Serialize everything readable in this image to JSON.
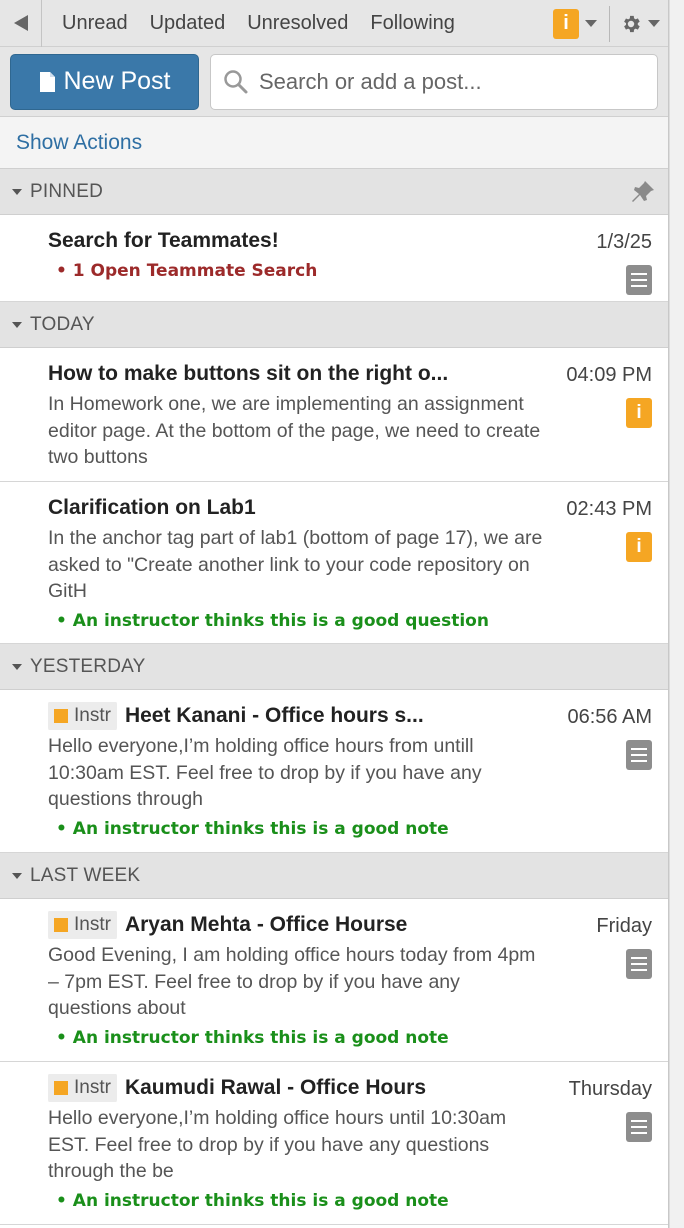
{
  "filters": [
    "Unread",
    "Updated",
    "Unresolved",
    "Following"
  ],
  "new_post_label": "New Post",
  "search_placeholder": "Search or add a post...",
  "show_actions_label": "Show Actions",
  "groups": [
    {
      "label": "PINNED",
      "items": [
        {
          "title": "Search for Teammates!",
          "snippet": "",
          "note": "• 1 Open Teammate Search",
          "date": "1/3/25",
          "icon": "note-icon",
          "instr": false
        }
      ]
    },
    {
      "label": "TODAY",
      "items": [
        {
          "title": "How to make buttons sit on the right o...",
          "snippet": "In Homework one, we are implementing an assignment editor page. At the bottom of the page, we need to create two buttons",
          "note": "",
          "date": "04:09 PM",
          "icon": "info-icon",
          "instr": false
        },
        {
          "title": "Clarification on Lab1",
          "snippet": "In the anchor tag part of lab1 (bottom of page 17), we are asked to \"Create another link to your code repository on GitH",
          "note": "• An instructor thinks this is a good question",
          "date": "02:43 PM",
          "icon": "info-icon",
          "instr": false
        }
      ]
    },
    {
      "label": "YESTERDAY",
      "items": [
        {
          "title": "Heet Kanani - Office hours s...",
          "snippet": "Hello everyone,I’m holding office hours from untill 10:30am EST. Feel free to drop by if you have any questions through",
          "note": "• An instructor thinks this is a good note",
          "date": "06:56 AM",
          "icon": "note-icon",
          "instr": true
        }
      ]
    },
    {
      "label": "LAST WEEK",
      "items": [
        {
          "title": "Aryan Mehta - Office Hourse",
          "snippet": "Good Evening, I am holding office hours today from 4pm – 7pm EST. Feel free to drop by if you have any questions about",
          "note": "• An instructor thinks this is a good note",
          "date": "Friday",
          "icon": "note-icon",
          "instr": true
        },
        {
          "title": "Kaumudi Rawal - Office Hours",
          "snippet": "Hello everyone,I’m holding office hours until 10:30am EST. Feel free to drop by if you have any questions through the be",
          "note": "• An instructor thinks this is a good note",
          "date": "Thursday",
          "icon": "note-icon",
          "instr": true
        }
      ]
    }
  ],
  "instr_label": "Instr",
  "info_glyph": "i",
  "colors": {
    "brand_blue": "#3a78a9",
    "info_orange": "#f5a623",
    "good_green": "#1a8f1a",
    "alert_red": "#9c2a2a"
  }
}
